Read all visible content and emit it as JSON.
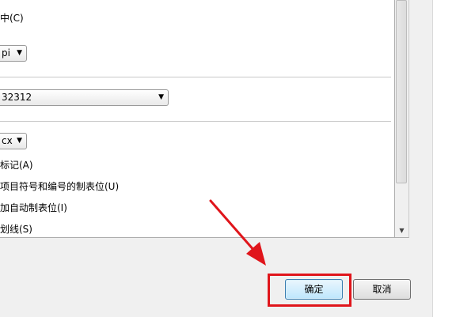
{
  "options": {
    "opt1_label": "中(C)",
    "resolution_value": "pi",
    "font_value": "32312",
    "unit_value": "cx",
    "check_mark_label": "标记(A)",
    "check_bullets_label": "项目符号和编号的制表位(U)",
    "check_autotab_label": "加自动制表位(I)",
    "check_lines_label": "划线(S)"
  },
  "buttons": {
    "ok_label": "确定",
    "cancel_label": "取消"
  },
  "colors": {
    "annotation": "#e0151b"
  }
}
